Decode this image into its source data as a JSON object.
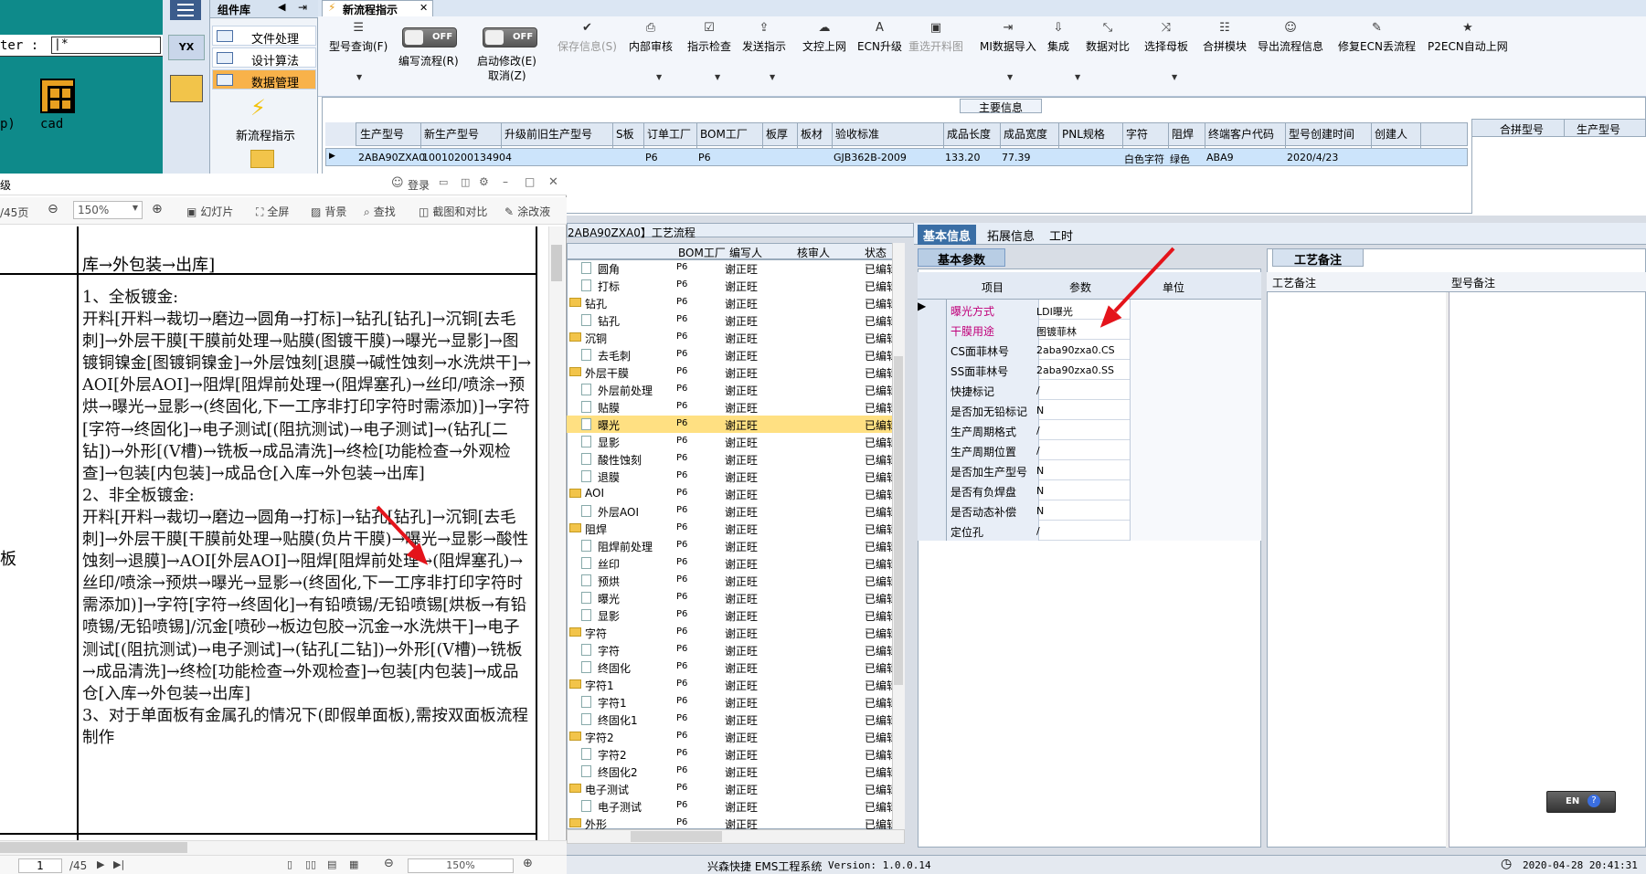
{
  "left_app": {
    "filter_label": "ter :",
    "filter_value": "|*",
    "cad_label": "cad",
    "p_label": "p)"
  },
  "component_panel": {
    "title": "组件库",
    "items": [
      "文件处理",
      "设计算法",
      "数据管理"
    ],
    "new_flow_label": "新流程指示"
  },
  "window_tab": "新流程指示",
  "toolbar": {
    "model_query": "型号查询(F)",
    "edit_flow": "编写流程(R)",
    "edit_flow_toggle": "OFF",
    "start_modify": "启动修改(E)",
    "start_modify_toggle": "OFF",
    "cancel": "取消(Z)",
    "buttons": [
      {
        "label": "保存信息(S)",
        "disabled": true
      },
      {
        "label": "内部审核",
        "disabled": false
      },
      {
        "label": "指示检查",
        "disabled": false
      },
      {
        "label": "发送指示",
        "disabled": false
      },
      {
        "label": "文控上网",
        "disabled": false
      },
      {
        "label": "ECN升级",
        "disabled": false
      },
      {
        "label": "重选开料图",
        "disabled": true
      },
      {
        "label": "MI数据导入",
        "disabled": false
      },
      {
        "label": "集成",
        "disabled": false
      },
      {
        "label": "数据对比",
        "disabled": false
      },
      {
        "label": "选择母板",
        "disabled": false
      },
      {
        "label": "合拼模块",
        "disabled": false
      },
      {
        "label": "导出流程信息",
        "disabled": false
      },
      {
        "label": "修复ECN丢流程",
        "disabled": false
      },
      {
        "label": "P2ECN自动上网",
        "disabled": false
      }
    ]
  },
  "main_info": {
    "title": "主要信息",
    "columns": [
      "生产型号",
      "新生产型号",
      "升级前旧生产型号",
      "S板",
      "订单工厂",
      "BOM工厂",
      "板厚",
      "板材",
      "验收标准",
      "成品长度",
      "成品宽度",
      "PNL规格",
      "字符",
      "阻焊",
      "终端客户代码",
      "型号创建时间",
      "创建人"
    ],
    "row": {
      "生产型号": "2ABA90ZXA0",
      "新生产型号": "10010200134904",
      "订单工厂": "P6",
      "BOM工厂": "P6",
      "验收标准": "GJB362B-2009",
      "成品长度": "133.20",
      "成品宽度": "77.39",
      "字符": "白色字符",
      "阻焊": "绿色",
      "终端客户代码": "ABA9",
      "型号创建时间": "2020/4/23"
    },
    "right_columns": [
      "合拼型号",
      "生产型号"
    ]
  },
  "tree": {
    "title": "2ABA90ZXA0】工艺流程",
    "columns": [
      "BOM工厂",
      "编写人",
      "核审人",
      "状态"
    ],
    "rows": [
      {
        "name": "圆角",
        "folder": false,
        "factory": "P6",
        "writer": "谢正旺",
        "status": "已编辑"
      },
      {
        "name": "打标",
        "folder": false,
        "factory": "P6",
        "writer": "谢正旺",
        "status": "已编辑"
      },
      {
        "name": "钻孔",
        "folder": true,
        "factory": "P6",
        "writer": "谢正旺",
        "status": "已编辑"
      },
      {
        "name": "钻孔",
        "folder": false,
        "factory": "P6",
        "writer": "谢正旺",
        "status": "已编辑"
      },
      {
        "name": "沉铜",
        "folder": true,
        "factory": "P6",
        "writer": "谢正旺",
        "status": "已编辑"
      },
      {
        "name": "去毛刺",
        "folder": false,
        "factory": "P6",
        "writer": "谢正旺",
        "status": "已编辑"
      },
      {
        "name": "外层干膜",
        "folder": true,
        "factory": "P6",
        "writer": "谢正旺",
        "status": "已编辑"
      },
      {
        "name": "外层前处理",
        "folder": false,
        "factory": "P6",
        "writer": "谢正旺",
        "status": "已编辑"
      },
      {
        "name": "贴膜",
        "folder": false,
        "factory": "P6",
        "writer": "谢正旺",
        "status": "已编辑"
      },
      {
        "name": "曝光",
        "folder": false,
        "factory": "P6",
        "writer": "谢正旺",
        "status": "已编辑",
        "selected": true
      },
      {
        "name": "显影",
        "folder": false,
        "factory": "P6",
        "writer": "谢正旺",
        "status": "已编辑"
      },
      {
        "name": "酸性蚀刻",
        "folder": false,
        "factory": "P6",
        "writer": "谢正旺",
        "status": "已编辑"
      },
      {
        "name": "退膜",
        "folder": false,
        "factory": "P6",
        "writer": "谢正旺",
        "status": "已编辑"
      },
      {
        "name": "AOI",
        "folder": true,
        "factory": "P6",
        "writer": "谢正旺",
        "status": "已编辑"
      },
      {
        "name": "外层AOI",
        "folder": false,
        "factory": "P6",
        "writer": "谢正旺",
        "status": "已编辑"
      },
      {
        "name": "阻焊",
        "folder": true,
        "factory": "P6",
        "writer": "谢正旺",
        "status": "已编辑"
      },
      {
        "name": "阻焊前处理",
        "folder": false,
        "factory": "P6",
        "writer": "谢正旺",
        "status": "已编辑"
      },
      {
        "name": "丝印",
        "folder": false,
        "factory": "P6",
        "writer": "谢正旺",
        "status": "已编辑"
      },
      {
        "name": "预烘",
        "folder": false,
        "factory": "P6",
        "writer": "谢正旺",
        "status": "已编辑"
      },
      {
        "name": "曝光",
        "folder": false,
        "factory": "P6",
        "writer": "谢正旺",
        "status": "已编辑"
      },
      {
        "name": "显影",
        "folder": false,
        "factory": "P6",
        "writer": "谢正旺",
        "status": "已编辑"
      },
      {
        "name": "字符",
        "folder": true,
        "factory": "P6",
        "writer": "谢正旺",
        "status": "已编辑"
      },
      {
        "name": "字符",
        "folder": false,
        "factory": "P6",
        "writer": "谢正旺",
        "status": "已编辑"
      },
      {
        "name": "终固化",
        "folder": false,
        "factory": "P6",
        "writer": "谢正旺",
        "status": "已编辑"
      },
      {
        "name": "字符1",
        "folder": true,
        "factory": "P6",
        "writer": "谢正旺",
        "status": "已编辑"
      },
      {
        "name": "字符1",
        "folder": false,
        "factory": "P6",
        "writer": "谢正旺",
        "status": "已编辑"
      },
      {
        "name": "终固化1",
        "folder": false,
        "factory": "P6",
        "writer": "谢正旺",
        "status": "已编辑"
      },
      {
        "name": "字符2",
        "folder": true,
        "factory": "P6",
        "writer": "谢正旺",
        "status": "已编辑"
      },
      {
        "name": "字符2",
        "folder": false,
        "factory": "P6",
        "writer": "谢正旺",
        "status": "已编辑"
      },
      {
        "name": "终固化2",
        "folder": false,
        "factory": "P6",
        "writer": "谢正旺",
        "status": "已编辑"
      },
      {
        "name": "电子测试",
        "folder": true,
        "factory": "P6",
        "writer": "谢正旺",
        "status": "已编辑"
      },
      {
        "name": "电子测试",
        "folder": false,
        "factory": "P6",
        "writer": "谢正旺",
        "status": "已编辑"
      },
      {
        "name": "外形",
        "folder": true,
        "factory": "P6",
        "writer": "谢正旺",
        "status": "已编辑"
      }
    ]
  },
  "detail_tabs": [
    "基本信息",
    "拓展信息",
    "工时"
  ],
  "basic": {
    "title": "基本参数",
    "columns": [
      "项目",
      "参数",
      "单位"
    ],
    "rows": [
      {
        "key": "曝光方式",
        "value": "LDI曝光",
        "highlight": true
      },
      {
        "key": "干膜用途",
        "value": "图镀菲林",
        "highlight": true
      },
      {
        "key": "CS面菲林号",
        "value": "2aba90zxa0.CS",
        "highlight": false
      },
      {
        "key": "SS面菲林号",
        "value": "2aba90zxa0.SS",
        "highlight": false
      },
      {
        "key": "快捷标记",
        "value": "/",
        "highlight": false
      },
      {
        "key": "是否加无铅标记",
        "value": "N",
        "highlight": false
      },
      {
        "key": "生产周期格式",
        "value": "/",
        "highlight": false
      },
      {
        "key": "生产周期位置",
        "value": "/",
        "highlight": false
      },
      {
        "key": "是否加生产型号",
        "value": "N",
        "highlight": false
      },
      {
        "key": "是否有负焊盘",
        "value": "N",
        "highlight": false
      },
      {
        "key": "是否动态补偿",
        "value": "N",
        "highlight": false
      },
      {
        "key": "定位孔",
        "value": "/",
        "highlight": false
      }
    ]
  },
  "craft": {
    "title": "工艺备注",
    "columns": [
      "工艺备注",
      "型号备注"
    ]
  },
  "pdf": {
    "title_fragment": "级",
    "page_total_label": "/45页",
    "zoom": "150%",
    "tools": [
      "幻灯片",
      "全屏",
      "背景",
      "查找",
      "截图和对比",
      "涂改液"
    ],
    "login": "登录",
    "top_text": "库→外包装→出库]",
    "side_text": "板",
    "paragraphs": [
      "1、全板镀金:",
      "开料[开料→裁切→磨边→圆角→打标]→钻孔[钻孔]→沉铜[去毛刺]→外层干膜[干膜前处理→贴膜(图镀干膜)→曝光→显影]→图镀铜镍金[图镀铜镍金]→外层蚀刻[退膜→碱性蚀刻→水洗烘干]→AOI[外层AOI]→阻焊[阻焊前处理→(阻焊塞孔)→丝印/喷涂→预烘→曝光→显影→(终固化,下一工序非打印字符时需添加)]→字符[字符→终固化]→电子测试[(阻抗测试)→电子测试]→(钻孔[二钻])→外形[(V槽)→铣板→成品清洗]→终检[功能检查→外观检查]→包装[内包装]→成品仓[入库→外包装→出库]",
      "2、非全板镀金:",
      "开料[开料→裁切→磨边→圆角→打标]→钻孔[钻孔]→沉铜[去毛刺]→外层干膜[干膜前处理→贴膜(负片干膜)→曝光→显影→酸性蚀刻→退膜]→AOI[外层AOI]→阻焊[阻焊前处理→(阻焊塞孔)→丝印/喷涂→预烘→曝光→显影→(终固化,下一工序非打印字符时需添加)]→字符[字符→终固化]→有铅喷锡/无铅喷锡[烘板→有铅喷锡/无铅喷锡]/沉金[喷砂→板边包胶→沉金→水洗烘干]→电子测试[(阻抗测试)→电子测试]→(钻孔[二钻])→外形[(V槽)→铣板→成品清洗]→终检[功能检查→外观检查]→包装[内包装]→成品仓[入库→外包装→出库]",
      "3、对于单面板有金属孔的情况下(即假单面板),需按双面板流程制作"
    ],
    "page_input": "1",
    "page_total": "/45",
    "footer_zoom": "150%"
  },
  "status": {
    "app_name": "兴森快捷 EMS工程系统",
    "version": "Version: 1.0.0.14",
    "datetime": "2020-04-28 20:41:31"
  },
  "lang_widget": "EN",
  "colors": {
    "accent": "#3a6ea5",
    "arrow": "#e4141b",
    "highlight_key": "#c0007a",
    "selected_row": "#ffe082"
  }
}
